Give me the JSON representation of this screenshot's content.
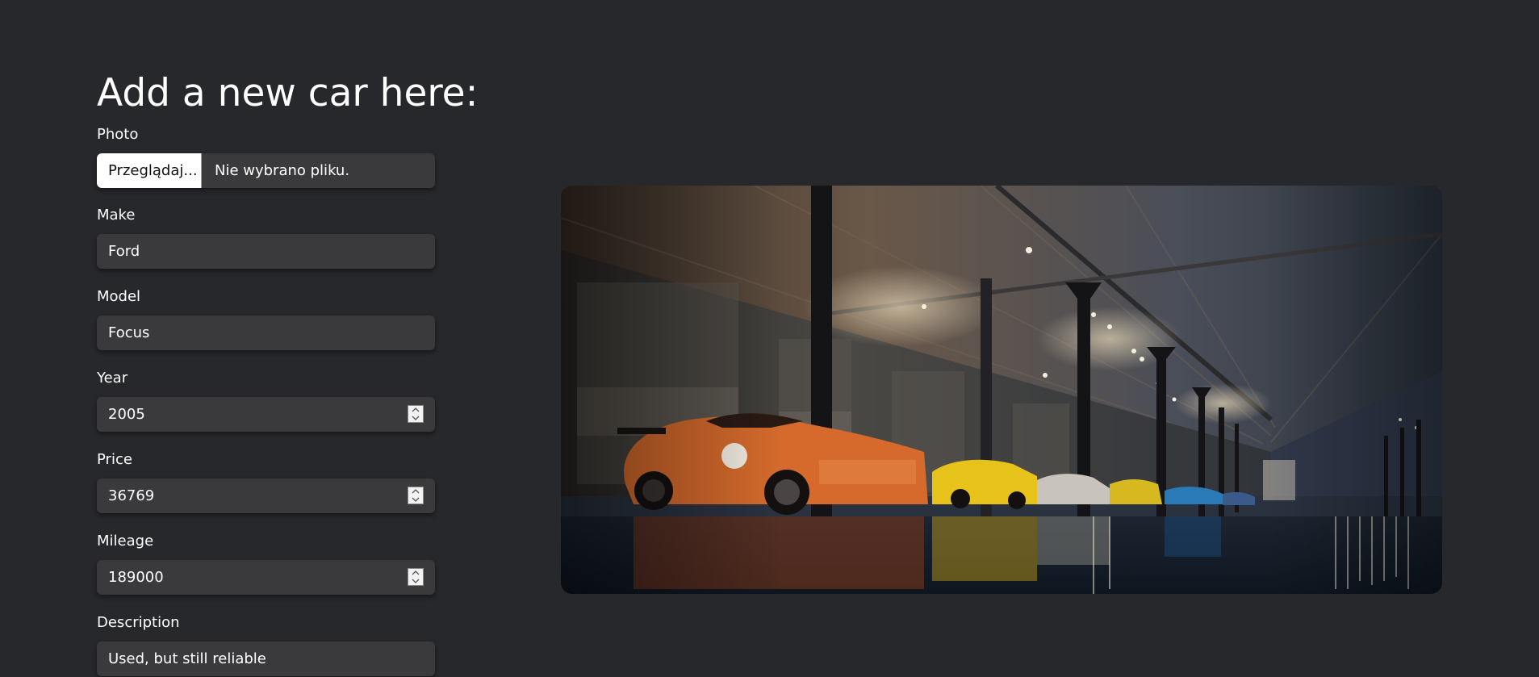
{
  "form": {
    "title": "Add a new car here:",
    "photo": {
      "label": "Photo",
      "button_label": "Przeglądaj...",
      "status": "Nie wybrano pliku."
    },
    "make": {
      "label": "Make",
      "value": "Ford"
    },
    "model": {
      "label": "Model",
      "value": "Focus"
    },
    "year": {
      "label": "Year",
      "value": "2005"
    },
    "price": {
      "label": "Price",
      "value": "36769"
    },
    "mileage": {
      "label": "Mileage",
      "value": "189000"
    },
    "description": {
      "label": "Description",
      "value": "Used, but still reliable"
    }
  },
  "hero": {
    "image_name": "car-garage-photo"
  },
  "colors": {
    "background": "#27282c",
    "input_background": "#3a3a3c",
    "text": "#ffffff"
  }
}
